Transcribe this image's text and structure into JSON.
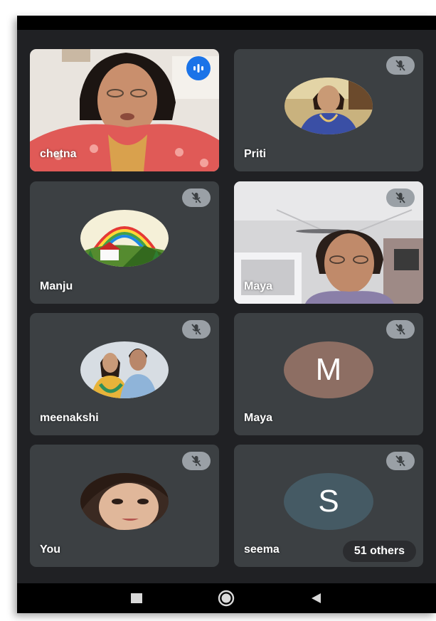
{
  "participants": [
    {
      "name": "chetna",
      "state": "speaking",
      "view": "video"
    },
    {
      "name": "Priti",
      "state": "muted",
      "view": "photo-avatar"
    },
    {
      "name": "Manju",
      "state": "muted",
      "view": "landscape-avatar"
    },
    {
      "name": "Maya",
      "state": "muted",
      "view": "video"
    },
    {
      "name": "meenakshi",
      "state": "muted",
      "view": "photo-avatar"
    },
    {
      "name": "Maya",
      "state": "muted",
      "view": "letter-avatar",
      "initial": "M",
      "avatar_color": "#8d6e63"
    },
    {
      "name": "You",
      "state": "muted",
      "view": "photo-avatar"
    },
    {
      "name": "seema",
      "state": "muted",
      "view": "letter-avatar",
      "initial": "S",
      "avatar_color": "#455a64"
    }
  ],
  "others_chip": "51 others",
  "icons": {
    "speaking": "audio-level-icon",
    "muted": "mic-off-icon",
    "nav": [
      "recents-icon",
      "home-icon",
      "back-icon"
    ]
  },
  "colors": {
    "background": "#202124",
    "tile": "#3c4043",
    "speaking_badge": "#1a73e8",
    "muted_badge": "#9aa0a6"
  }
}
